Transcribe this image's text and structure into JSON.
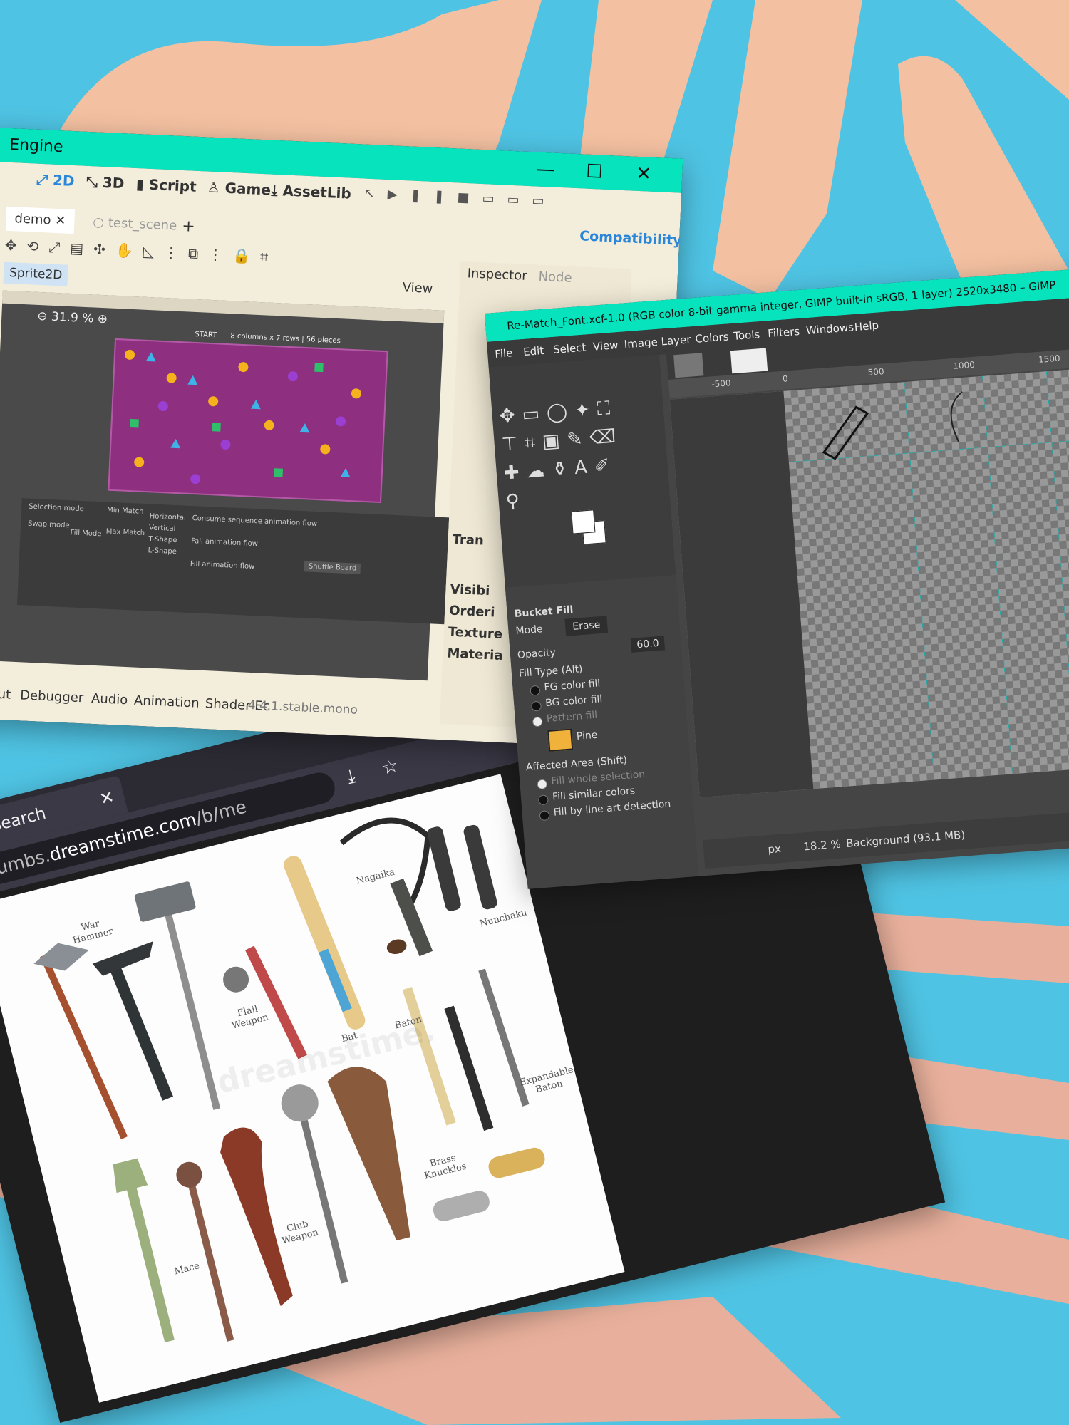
{
  "browser": {
    "tab_title": "Google Search",
    "tab_close": "✕",
    "url_prefix": "thumbs.",
    "url_domain": "dreamstime.com",
    "url_rest": "/b/me",
    "image_labels": {
      "war_hammer": "War Hammer",
      "nunchaku": "Nunchaku",
      "nagaika": "Nagaika",
      "flail": "Flail Weapon",
      "bat": "Bat",
      "baton": "Baton",
      "mace": "Mace",
      "club": "Club Weapon",
      "brass_knuckles": "Brass Knuckles",
      "expandable": "Expandable Baton"
    },
    "watermark": "dreamstime."
  },
  "godot": {
    "title": "Engine",
    "toolbar": {
      "twoD": "2D",
      "threeD": "3D",
      "script": "Script",
      "game": "Game",
      "assetlib": "AssetLib"
    },
    "tabs": {
      "demo": "demo",
      "test_scene": "test_scene"
    },
    "compatibility": "Compatibility",
    "node_chip": "Sprite2D",
    "view_btn": "View",
    "zoom": "31.9 %",
    "board_header": "START",
    "board_info": "8 columns x 7 rows | 56 pieces",
    "panel": {
      "selection_mode": "Selection mode",
      "swap_mode": "Swap mode",
      "fill_mode": "Fill Mode",
      "min_match": "Min Match",
      "max_match": "Max Match",
      "horizontal": "Horizontal",
      "vertical": "Vertical",
      "tshape": "T-Shape",
      "lshape": "L-Shape",
      "consume_flow": "Consume sequence animation flow",
      "fall_flow": "Fall animation flow",
      "fill_flow": "Fill animation flow",
      "shuffle": "Shuffle Board"
    },
    "bottom": {
      "output": "tput",
      "debugger": "Debugger",
      "audio": "Audio",
      "animation": "Animation",
      "shader": "Shader Ec"
    },
    "version": "4.4.1.stable.mono",
    "inspector": {
      "tab_inspector": "Inspector",
      "tab_node": "Node",
      "items": [
        "Tran",
        "Visibi",
        "Orderi",
        "Texture",
        "Materia"
      ]
    }
  },
  "gimp": {
    "title": "Re-Match_Font.xcf-1.0 (RGB color 8-bit gamma integer, GIMP built-in sRGB, 1 layer) 2520x3480 – GIMP",
    "menu": [
      "File",
      "Edit",
      "Select",
      "View",
      "Image",
      "Layer",
      "Colors",
      "Tools",
      "Filters",
      "Windows",
      "Help"
    ],
    "tool_name": "Bucket Fill",
    "mode_label": "Mode",
    "mode_value": "Erase",
    "opacity_label": "Opacity",
    "opacity_value": "60.0",
    "fill_type_label": "Fill Type  (Alt)",
    "fill_types": [
      "FG color fill",
      "BG color fill",
      "Pattern fill"
    ],
    "pattern_name": "Pine",
    "affected_label": "Affected Area  (Shift)",
    "affected": [
      "Fill whole selection",
      "Fill similar colors",
      "Fill by line art detection"
    ],
    "ruler_marks": [
      "-500",
      "0",
      "500",
      "1000",
      "1500"
    ],
    "unit": "px",
    "zoom": "18.2 %",
    "layer_status": "Background (93.1 MB)",
    "accent": "#07e3bd"
  },
  "colors": {
    "background": "#4fc3e3",
    "shape": "#f3c0a1",
    "titlebar": "#07e3bd"
  }
}
